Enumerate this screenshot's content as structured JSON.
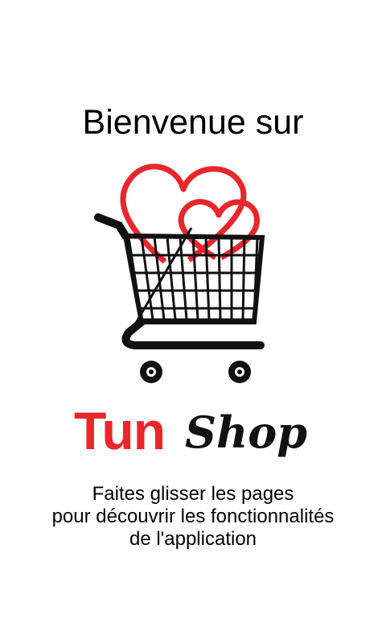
{
  "welcome": {
    "title": "Bienvenue sur"
  },
  "logo": {
    "icon": "shopping-cart-hearts-icon",
    "brand_part1": "Tun",
    "brand_part2": "Shop",
    "colors": {
      "heart": "#e8262b",
      "tun": "#e8262b",
      "shop": "#111111",
      "cart": "#111111"
    }
  },
  "instructions": {
    "lines": [
      "Faites glisser les pages",
      "pour découvrir les fonctionnalités",
      "de l'application"
    ]
  }
}
